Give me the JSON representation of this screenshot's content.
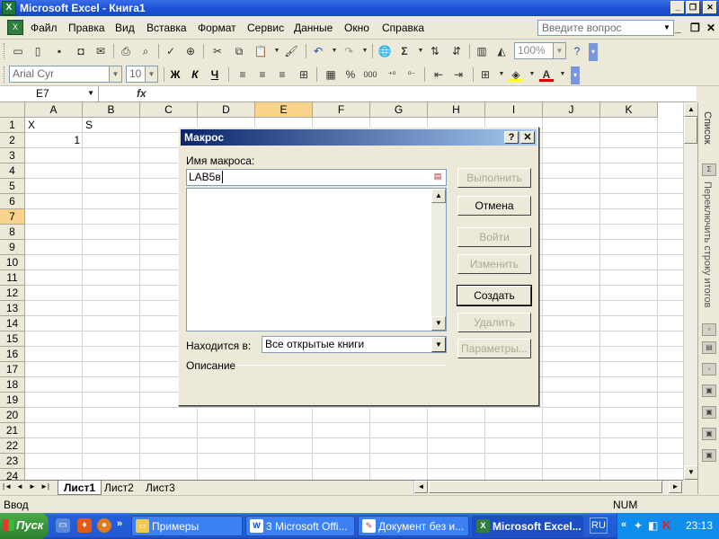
{
  "window": {
    "title": "Microsoft Excel - Книга1"
  },
  "menu": {
    "items": [
      "Файл",
      "Правка",
      "Вид",
      "Вставка",
      "Формат",
      "Сервис",
      "Данные",
      "Окно",
      "Справка"
    ],
    "ask_placeholder": "Введите вопрос"
  },
  "toolbar": {
    "font": "Arial Cyr",
    "size": "10",
    "zoom": "100%",
    "bold": "Ж",
    "italic": "К",
    "underline": "Ч",
    "sum": "Σ",
    "percent": "%",
    "thousands": "000",
    "font_color_label": "A"
  },
  "formula_bar": {
    "cell_ref": "E7",
    "fx": "fx",
    "content": ""
  },
  "grid": {
    "columns": [
      "A",
      "B",
      "C",
      "D",
      "E",
      "F",
      "G",
      "H",
      "I",
      "J",
      "K"
    ],
    "selected_column": "E",
    "rows": [
      "1",
      "2",
      "3",
      "4",
      "5",
      "6",
      "7",
      "8",
      "9",
      "10",
      "11",
      "12",
      "13",
      "14",
      "15",
      "16",
      "17",
      "18",
      "19",
      "20",
      "21",
      "22",
      "23",
      "24"
    ],
    "selected_row": "7",
    "cells": {
      "A1": "X",
      "B1": "S",
      "A2": "1"
    }
  },
  "sheets": {
    "tabs": [
      "Лист1",
      "Лист2",
      "Лист3"
    ],
    "active": "Лист1"
  },
  "task_pane": {
    "title": "Список",
    "label": "Переключить строку итогов"
  },
  "status": {
    "mode": "Ввод",
    "num": "NUM"
  },
  "dialog": {
    "title": "Макрос",
    "name_label": "Имя макроса:",
    "name_value": "LAB5в",
    "location_label": "Находится в:",
    "location_value": "Все открытые книги",
    "description_label": "Описание",
    "buttons": {
      "run": "Выполнить",
      "cancel": "Отмена",
      "step_into": "Войти",
      "edit": "Изменить",
      "create": "Создать",
      "delete": "Удалить",
      "options": "Параметры..."
    }
  },
  "taskbar": {
    "start": "Пуск",
    "tasks": [
      "Примеры",
      "3 Microsoft Offi...",
      "Документ без и...",
      "Microsoft Excel..."
    ],
    "active_task": "Microsoft Excel...",
    "lang": "RU",
    "time": "23:13"
  }
}
